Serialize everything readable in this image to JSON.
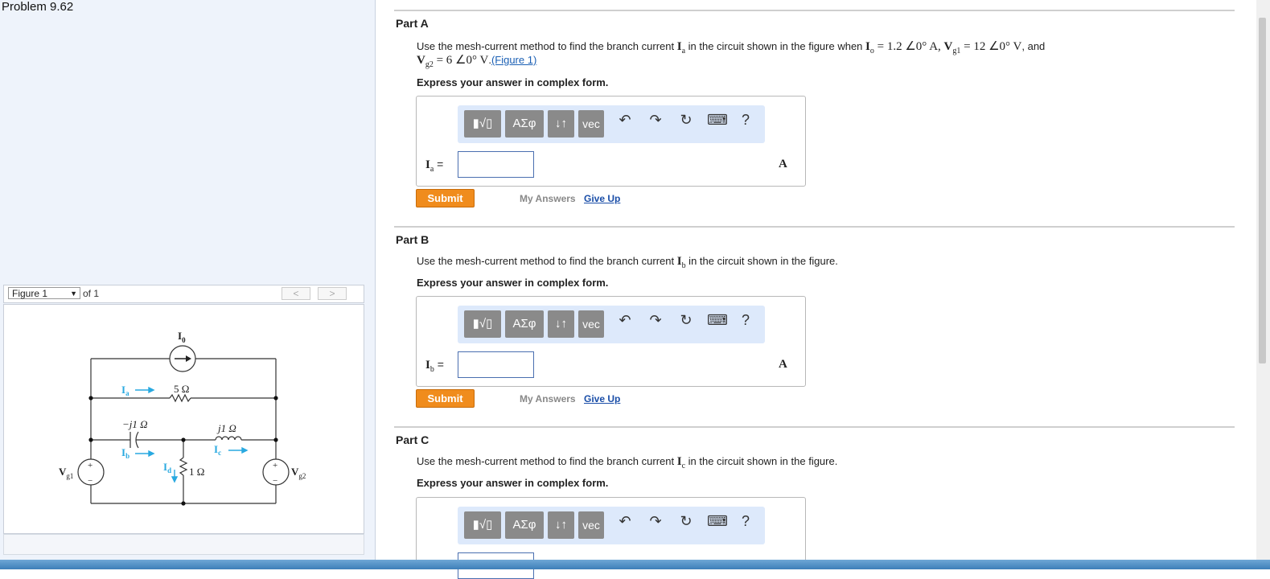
{
  "problem_title": "Problem 9.62",
  "figure_nav": {
    "select_value": "Figure 1",
    "of_label": "of 1",
    "prev_label": "<",
    "next_label": ">"
  },
  "circuit": {
    "labels": {
      "Io": "I",
      "Io_sub": "0",
      "Ia": "I",
      "Ia_sub": "a",
      "Ib": "I",
      "Ib_sub": "b",
      "Ic": "I",
      "Ic_sub": "c",
      "Id": "I",
      "Id_sub": "d",
      "r5": "5 Ω",
      "cap": "−j1 Ω",
      "ind": "j1 Ω",
      "r1": "1 Ω",
      "Vg1": "V",
      "Vg1_sub": "g1",
      "Vg2": "V",
      "Vg2_sub": "g2",
      "plus": "+",
      "minus": "−"
    }
  },
  "toolbar": {
    "templates_label": "▮√▯",
    "greek_label": "ΑΣφ",
    "arrows_label": "↓↑",
    "vec_label": "vec",
    "undo_icon": "↶",
    "redo_icon": "↷",
    "reset_icon": "↻",
    "keyboard_icon": "⌨",
    "help_label": "?"
  },
  "parts": [
    {
      "title": "Part A",
      "question_pre": "Use the mesh-current method to find the branch current ",
      "current_symbol": "I",
      "current_sub": "a",
      "question_mid": " in the circuit shown in the figure when ",
      "given_1": "I",
      "given_1_sub": "o",
      "given_1_val": " = 1.2 ∠0° A, ",
      "given_2": "V",
      "given_2_sub": "g1",
      "given_2_val": " = 12 ∠0° V",
      "question_and": ", and",
      "given_3": "V",
      "given_3_sub": "g2",
      "given_3_val": " = 6 ∠0° V",
      "figure_link": "(Figure 1)",
      "express": "Express your answer in complex form.",
      "answer_label": "I",
      "answer_sub": "a",
      "answer_eq": " =",
      "unit": "A",
      "submit": "Submit",
      "my_answers": "My Answers",
      "give_up": "Give Up"
    },
    {
      "title": "Part B",
      "question_pre": "Use the mesh-current method to find the branch current ",
      "current_symbol": "I",
      "current_sub": "b",
      "question_post": " in the circuit shown in the figure.",
      "express": "Express your answer in complex form.",
      "answer_label": "I",
      "answer_sub": "b",
      "answer_eq": " =",
      "unit": "A",
      "submit": "Submit",
      "my_answers": "My Answers",
      "give_up": "Give Up"
    },
    {
      "title": "Part C",
      "question_pre": "Use the mesh-current method to find the branch current ",
      "current_symbol": "I",
      "current_sub": "c",
      "question_post": " in the circuit shown in the figure.",
      "express": "Express your answer in complex form."
    }
  ]
}
